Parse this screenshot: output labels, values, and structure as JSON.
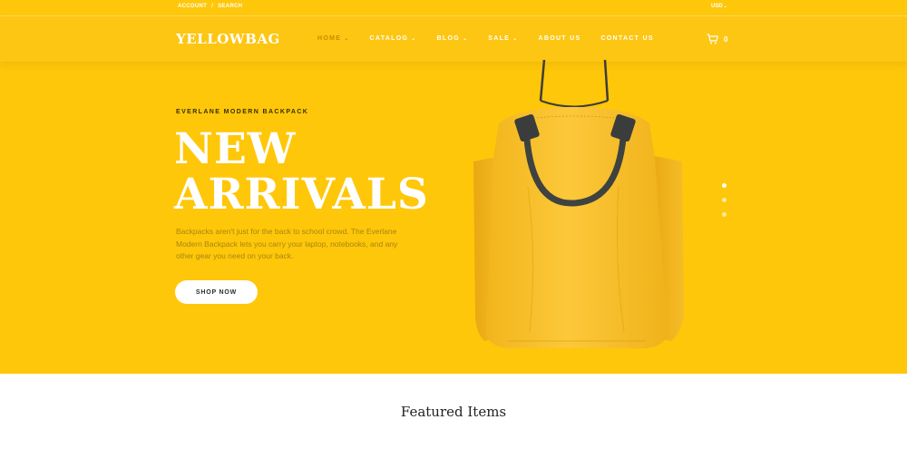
{
  "topbar": {
    "account": "ACCOUNT",
    "separator": "/",
    "search": "SEARCH",
    "currency": "USD"
  },
  "header": {
    "logo_yellow": "YELLOW",
    "logo_bag": "BAG",
    "nav": [
      {
        "label": "HOME",
        "dropdown": true,
        "active": true
      },
      {
        "label": "CATALOG",
        "dropdown": true
      },
      {
        "label": "BLOG",
        "dropdown": true
      },
      {
        "label": "SALE",
        "dropdown": true
      },
      {
        "label": "ABOUT US",
        "dropdown": false
      },
      {
        "label": "CONTACT US",
        "dropdown": false
      }
    ],
    "cart_count": "0",
    "cart_icon": "cart-icon"
  },
  "hero": {
    "eyebrow": "EVERLANE MODERN BACKPACK",
    "headline_line1": "NEW",
    "headline_line2": "ARRIVALS",
    "description": "Backpacks aren't just for the back to school crowd. The Everlane Modern Backpack lets you carry your laptop, notebooks, and any other gear you need on your back.",
    "cta": "SHOP NOW",
    "slide_count": 3,
    "active_slide": 1
  },
  "featured": {
    "title": "Featured Items"
  },
  "colors": {
    "hero_bg": "#fec70a",
    "active_nav": "#c98a00",
    "white": "#ffffff"
  }
}
